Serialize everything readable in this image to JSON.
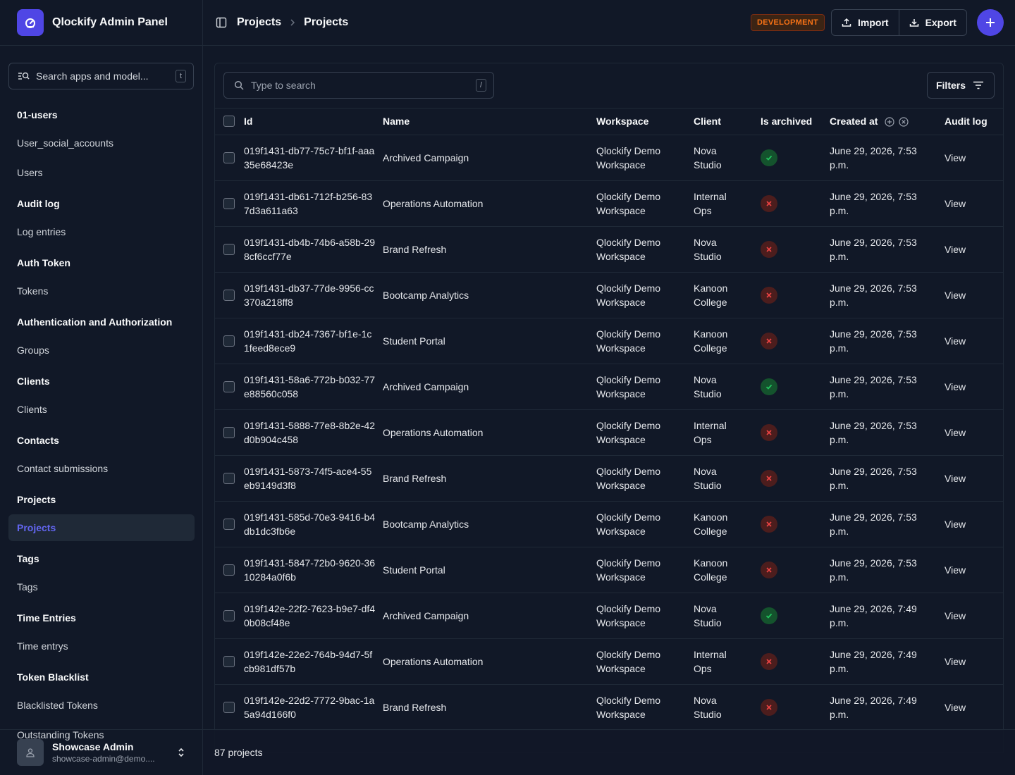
{
  "app": {
    "title": "Qlockify Admin Panel"
  },
  "sidebar": {
    "search_placeholder": "Search apps and model...",
    "search_shortcut": "t",
    "sections": [
      {
        "heading": "01-users",
        "items": [
          {
            "label": "User_social_accounts",
            "active": false
          },
          {
            "label": "Users",
            "active": false
          }
        ]
      },
      {
        "heading": "Audit log",
        "items": [
          {
            "label": "Log entries",
            "active": false
          }
        ]
      },
      {
        "heading": "Auth Token",
        "items": [
          {
            "label": "Tokens",
            "active": false
          }
        ]
      },
      {
        "heading": "Authentication and Authorization",
        "items": [
          {
            "label": "Groups",
            "active": false
          }
        ]
      },
      {
        "heading": "Clients",
        "items": [
          {
            "label": "Clients",
            "active": false
          }
        ]
      },
      {
        "heading": "Contacts",
        "items": [
          {
            "label": "Contact submissions",
            "active": false
          }
        ]
      },
      {
        "heading": "Projects",
        "items": [
          {
            "label": "Projects",
            "active": true
          }
        ]
      },
      {
        "heading": "Tags",
        "items": [
          {
            "label": "Tags",
            "active": false
          }
        ]
      },
      {
        "heading": "Time Entries",
        "items": [
          {
            "label": "Time entrys",
            "active": false
          }
        ]
      },
      {
        "heading": "Token Blacklist",
        "items": [
          {
            "label": "Blacklisted Tokens",
            "active": false
          },
          {
            "label": "Outstanding Tokens",
            "active": false
          }
        ]
      }
    ]
  },
  "user": {
    "name": "Showcase Admin",
    "email": "showcase-admin@demo...."
  },
  "header": {
    "breadcrumb": [
      "Projects",
      "Projects"
    ],
    "env_badge": "DEVELOPMENT",
    "import_label": "Import",
    "export_label": "Export"
  },
  "toolbar": {
    "search_placeholder": "Type to search",
    "search_shortcut": "/",
    "filters_label": "Filters"
  },
  "table": {
    "columns": [
      "Id",
      "Name",
      "Workspace",
      "Client",
      "Is archived",
      "Created at",
      "Audit log"
    ],
    "rows": [
      {
        "id": "019f1431-db77-75c7-bf1f-aaa35e68423e",
        "name": "Archived Campaign",
        "workspace": "Qlockify Demo Workspace",
        "client": "Nova Studio",
        "archived": true,
        "created": "June 29, 2026, 7:53 p.m.",
        "audit": "View"
      },
      {
        "id": "019f1431-db61-712f-b256-837d3a611a63",
        "name": "Operations Automation",
        "workspace": "Qlockify Demo Workspace",
        "client": "Internal Ops",
        "archived": false,
        "created": "June 29, 2026, 7:53 p.m.",
        "audit": "View"
      },
      {
        "id": "019f1431-db4b-74b6-a58b-298cf6ccf77e",
        "name": "Brand Refresh",
        "workspace": "Qlockify Demo Workspace",
        "client": "Nova Studio",
        "archived": false,
        "created": "June 29, 2026, 7:53 p.m.",
        "audit": "View"
      },
      {
        "id": "019f1431-db37-77de-9956-cc370a218ff8",
        "name": "Bootcamp Analytics",
        "workspace": "Qlockify Demo Workspace",
        "client": "Kanoon College",
        "archived": false,
        "created": "June 29, 2026, 7:53 p.m.",
        "audit": "View"
      },
      {
        "id": "019f1431-db24-7367-bf1e-1c1feed8ece9",
        "name": "Student Portal",
        "workspace": "Qlockify Demo Workspace",
        "client": "Kanoon College",
        "archived": false,
        "created": "June 29, 2026, 7:53 p.m.",
        "audit": "View"
      },
      {
        "id": "019f1431-58a6-772b-b032-77e88560c058",
        "name": "Archived Campaign",
        "workspace": "Qlockify Demo Workspace",
        "client": "Nova Studio",
        "archived": true,
        "created": "June 29, 2026, 7:53 p.m.",
        "audit": "View"
      },
      {
        "id": "019f1431-5888-77e8-8b2e-42d0b904c458",
        "name": "Operations Automation",
        "workspace": "Qlockify Demo Workspace",
        "client": "Internal Ops",
        "archived": false,
        "created": "June 29, 2026, 7:53 p.m.",
        "audit": "View"
      },
      {
        "id": "019f1431-5873-74f5-ace4-55eb9149d3f8",
        "name": "Brand Refresh",
        "workspace": "Qlockify Demo Workspace",
        "client": "Nova Studio",
        "archived": false,
        "created": "June 29, 2026, 7:53 p.m.",
        "audit": "View"
      },
      {
        "id": "019f1431-585d-70e3-9416-b4db1dc3fb6e",
        "name": "Bootcamp Analytics",
        "workspace": "Qlockify Demo Workspace",
        "client": "Kanoon College",
        "archived": false,
        "created": "June 29, 2026, 7:53 p.m.",
        "audit": "View"
      },
      {
        "id": "019f1431-5847-72b0-9620-3610284a0f6b",
        "name": "Student Portal",
        "workspace": "Qlockify Demo Workspace",
        "client": "Kanoon College",
        "archived": false,
        "created": "June 29, 2026, 7:53 p.m.",
        "audit": "View"
      },
      {
        "id": "019f142e-22f2-7623-b9e7-df40b08cf48e",
        "name": "Archived Campaign",
        "workspace": "Qlockify Demo Workspace",
        "client": "Nova Studio",
        "archived": true,
        "created": "June 29, 2026, 7:49 p.m.",
        "audit": "View"
      },
      {
        "id": "019f142e-22e2-764b-94d7-5fcb981df57b",
        "name": "Operations Automation",
        "workspace": "Qlockify Demo Workspace",
        "client": "Internal Ops",
        "archived": false,
        "created": "June 29, 2026, 7:49 p.m.",
        "audit": "View"
      },
      {
        "id": "019f142e-22d2-7772-9bac-1a5a94d166f0",
        "name": "Brand Refresh",
        "workspace": "Qlockify Demo Workspace",
        "client": "Nova Studio",
        "archived": false,
        "created": "June 29, 2026, 7:49 p.m.",
        "audit": "View"
      }
    ]
  },
  "footer": {
    "count": "87 projects"
  },
  "colors": {
    "accent": "#4f46e5",
    "active_text": "#6366f1",
    "badge": "#f97316",
    "archived_yes": "#22c55e",
    "archived_no": "#ef4444"
  }
}
